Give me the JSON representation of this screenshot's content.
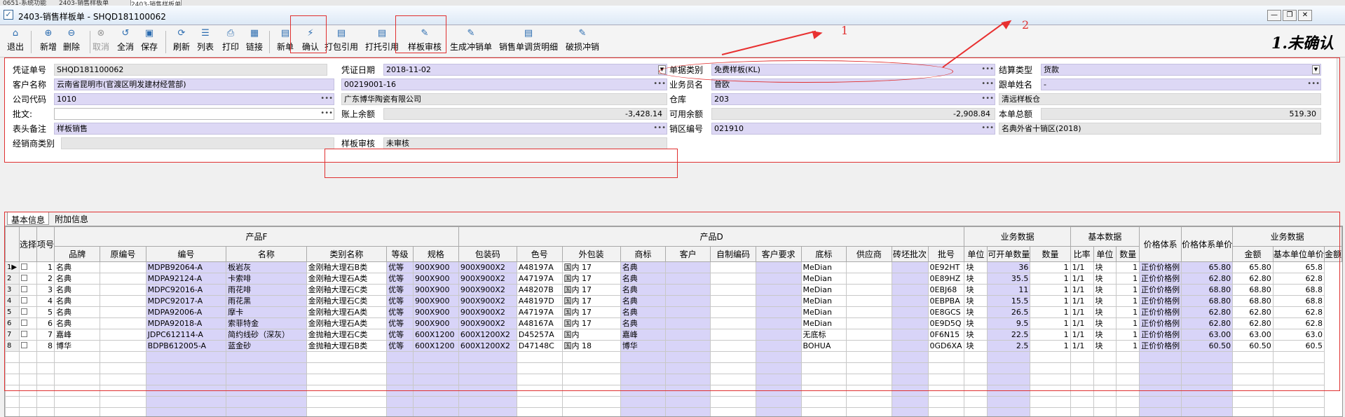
{
  "top_tabs": [
    "0651-系统功能",
    "2403-销售样板单",
    "2403-销售样板单"
  ],
  "window": {
    "title": "2403-销售样板单 - SHQD181100062",
    "min": "—",
    "max": "❐",
    "close": "✕"
  },
  "toolbar": [
    {
      "label": "退出",
      "icon": "⌂"
    },
    {
      "label": "新增",
      "icon": "⊕"
    },
    {
      "label": "删除",
      "icon": "⊖"
    },
    {
      "label": "取消",
      "icon": "⊗",
      "disabled": true
    },
    {
      "label": "全消",
      "icon": "↺"
    },
    {
      "label": "保存",
      "icon": "▣"
    },
    {
      "label": "刷新",
      "icon": "⟳"
    },
    {
      "label": "列表",
      "icon": "☰"
    },
    {
      "label": "打印",
      "icon": "⎙"
    },
    {
      "label": "链接",
      "icon": "▦"
    },
    {
      "label": "新单",
      "icon": "▤"
    },
    {
      "label": "确认",
      "icon": "⚡"
    },
    {
      "label": "打包引用",
      "icon": "▤"
    },
    {
      "label": "打托引用",
      "icon": "▤"
    },
    {
      "label": "样板审核",
      "icon": "✎"
    },
    {
      "label": "生成冲销单",
      "icon": "✎"
    },
    {
      "label": "销售单调货明细",
      "icon": "▤"
    },
    {
      "label": "破损冲销",
      "icon": "✎"
    }
  ],
  "status": "1.未确认",
  "annotations": [
    "1",
    "2"
  ],
  "form": {
    "voucher_no": {
      "label": "凭证单号",
      "value": "SHQD181100062"
    },
    "voucher_date": {
      "label": "凭证日期",
      "value": "2018-11-02"
    },
    "doc_type": {
      "label": "单据类别",
      "value": "免费样板(KL)"
    },
    "settle_type": {
      "label": "结算类型",
      "value": "货款"
    },
    "customer": {
      "label": "客户名称",
      "value": "云南省昆明市(官渡区明发建材经营部)",
      "code": "00219001-16"
    },
    "salesman": {
      "label": "业务员名",
      "value": "曾欧"
    },
    "follower": {
      "label": "跟单姓名",
      "value": "-"
    },
    "company": {
      "label": "公司代码",
      "value": "1010",
      "name": "广东博华陶瓷有限公司"
    },
    "warehouse": {
      "label": "仓库",
      "code": "203",
      "name": "清远样板仓"
    },
    "remark": {
      "label": "批文:",
      "value": ""
    },
    "account_balance": {
      "label": "账上余额",
      "value": "-3,428.14"
    },
    "available": {
      "label": "可用余额",
      "value": "-2,908.84"
    },
    "total": {
      "label": "本单总额",
      "value": "519.30"
    },
    "header_note": {
      "label": "表头备注",
      "value": "样板销售"
    },
    "region": {
      "label": "销区编号",
      "code": "021910",
      "name": "名典外省十销区(2018)"
    },
    "dealer_type": {
      "label": "经销商类别",
      "value": ""
    },
    "sample_audit": {
      "label": "样板审核",
      "value": "未审核"
    }
  },
  "tabs": [
    "基本信息",
    "附加信息"
  ],
  "grid": {
    "groups": {
      "select": "选择",
      "item": "项号",
      "prodF": "产品F",
      "prodD": "产品D",
      "biz": "业务数据",
      "base": "基本数据",
      "price_sys": "价格体系",
      "price_unit": "价格体系单价",
      "biz2": "业务数据"
    },
    "cols": [
      "品牌",
      "原编号",
      "编号",
      "名称",
      "类别名称",
      "等级",
      "规格",
      "包装码",
      "色号",
      "外包装",
      "商标",
      "客户",
      "自制编码",
      "客户要求",
      "底标",
      "供应商",
      "砖坯批次",
      "批号",
      "单位",
      "可开单数量",
      "数量",
      "比率",
      "单位",
      "数量",
      "基本单位单价",
      "金额"
    ],
    "rows": [
      [
        "名典",
        "",
        "MDPB92064-A",
        "板岩灰",
        "金刚釉大理石B类",
        "优等",
        "900X900",
        "900X900X2",
        "A48197A",
        "国内 17",
        "名典",
        "",
        "",
        "",
        "MeDian",
        "",
        "",
        "0E92HT",
        "块",
        "36",
        "1",
        "1/1",
        "块",
        "1",
        "正价价格例",
        "65.80",
        "65.80",
        "65.8"
      ],
      [
        "名典",
        "",
        "MDPA92124-A",
        "卡索啡",
        "金刚釉大理石A类",
        "优等",
        "900X900",
        "900X900X2",
        "A47197A",
        "国内 17",
        "名典",
        "",
        "",
        "",
        "MeDian",
        "",
        "",
        "0E89HZ",
        "块",
        "35.5",
        "1",
        "1/1",
        "块",
        "1",
        "正价价格例",
        "62.80",
        "62.80",
        "62.8"
      ],
      [
        "名典",
        "",
        "MDPC92016-A",
        "雨花啡",
        "金刚釉大理石C类",
        "优等",
        "900X900",
        "900X900X2",
        "A48207B",
        "国内 17",
        "名典",
        "",
        "",
        "",
        "MeDian",
        "",
        "",
        "0EBJ68",
        "块",
        "11",
        "1",
        "1/1",
        "块",
        "1",
        "正价价格例",
        "68.80",
        "68.80",
        "68.8"
      ],
      [
        "名典",
        "",
        "MDPC92017-A",
        "雨花黑",
        "金刚釉大理石C类",
        "优等",
        "900X900",
        "900X900X2",
        "A48197D",
        "国内 17",
        "名典",
        "",
        "",
        "",
        "MeDian",
        "",
        "",
        "0EBPBA",
        "块",
        "15.5",
        "1",
        "1/1",
        "块",
        "1",
        "正价价格例",
        "68.80",
        "68.80",
        "68.8"
      ],
      [
        "名典",
        "",
        "MDPA92006-A",
        "摩卡",
        "金刚釉大理石A类",
        "优等",
        "900X900",
        "900X900X2",
        "A47197A",
        "国内 17",
        "名典",
        "",
        "",
        "",
        "MeDian",
        "",
        "",
        "0E8GCS",
        "块",
        "26.5",
        "1",
        "1/1",
        "块",
        "1",
        "正价价格例",
        "62.80",
        "62.80",
        "62.8"
      ],
      [
        "名典",
        "",
        "MDPA92018-A",
        "索菲特金",
        "金刚釉大理石A类",
        "优等",
        "900X900",
        "900X900X2",
        "A48167A",
        "国内 17",
        "名典",
        "",
        "",
        "",
        "MeDian",
        "",
        "",
        "0E9D5Q",
        "块",
        "9.5",
        "1",
        "1/1",
        "块",
        "1",
        "正价价格例",
        "62.80",
        "62.80",
        "62.8"
      ],
      [
        "嘉峰",
        "",
        "JDPC612114-A",
        "简约线砂（深灰）",
        "金抛釉大理石C类",
        "优等",
        "600X1200",
        "600X1200X2",
        "D45257A",
        "国内",
        "嘉峰",
        "",
        "",
        "",
        "无底标",
        "",
        "",
        "0F6N15",
        "块",
        "22.5",
        "1",
        "1/1",
        "块",
        "1",
        "正价价格例",
        "63.00",
        "63.00",
        "63.0"
      ],
      [
        "博华",
        "",
        "BDPB612005-A",
        "蓝金砂",
        "金抛釉大理石B类",
        "优等",
        "600X1200",
        "600X1200X2",
        "D47148C",
        "国内 18",
        "博华",
        "",
        "",
        "",
        "BOHUA",
        "",
        "",
        "0GD6XA",
        "块",
        "2.5",
        "1",
        "1/1",
        "块",
        "1",
        "正价价格例",
        "60.50",
        "60.50",
        "60.5"
      ]
    ]
  }
}
